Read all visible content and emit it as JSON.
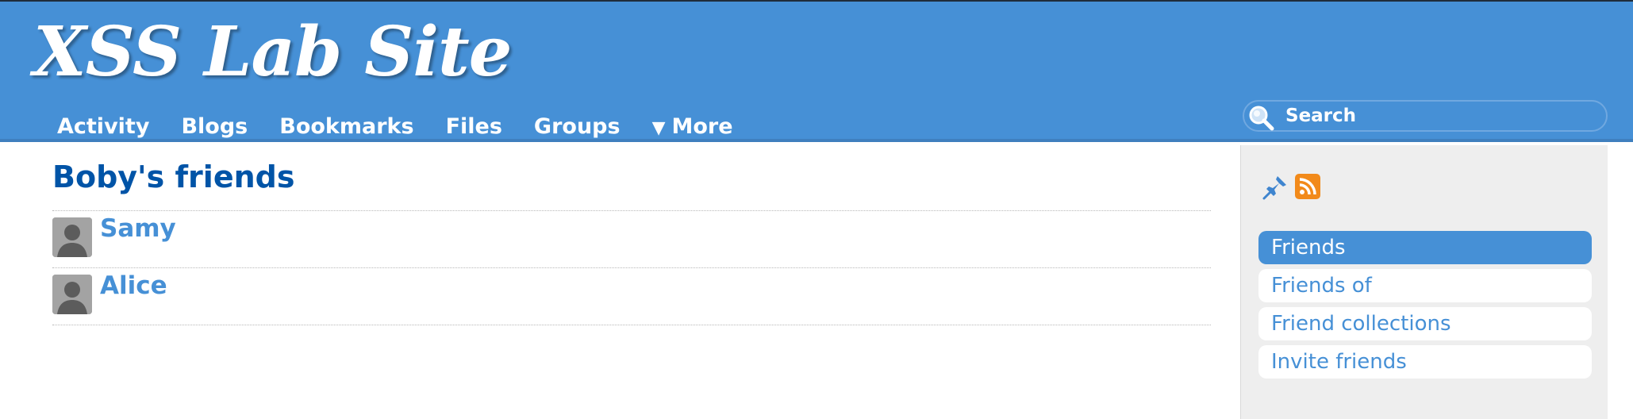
{
  "site": {
    "title": "XSS Lab Site"
  },
  "nav": {
    "items": [
      {
        "label": "Activity"
      },
      {
        "label": "Blogs"
      },
      {
        "label": "Bookmarks"
      },
      {
        "label": "Files"
      },
      {
        "label": "Groups"
      },
      {
        "label": "More",
        "caret": "▼"
      }
    ]
  },
  "search": {
    "placeholder": "Search",
    "icon": "search-icon"
  },
  "main": {
    "title": "Boby's friends",
    "friends": [
      {
        "name": "Samy",
        "icon": "avatar-default-icon"
      },
      {
        "name": "Alice",
        "icon": "avatar-default-icon"
      }
    ]
  },
  "sidebar": {
    "icons": [
      "pin-icon",
      "rss-icon"
    ],
    "menu": [
      {
        "label": "Friends",
        "selected": true
      },
      {
        "label": "Friends of",
        "selected": false
      },
      {
        "label": "Friend collections",
        "selected": false
      },
      {
        "label": "Invite friends",
        "selected": false
      }
    ]
  },
  "colors": {
    "header": "#4690d6",
    "title_blue": "#0054a7",
    "link_blue": "#4690d6",
    "sidebar_bg": "#eeeeee",
    "rss_orange": "#f28a1a"
  }
}
